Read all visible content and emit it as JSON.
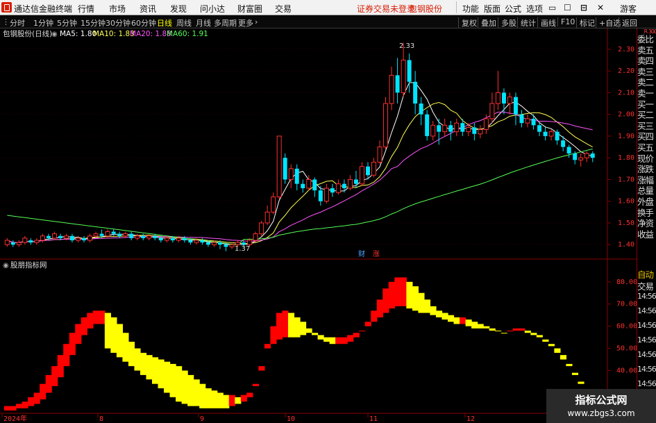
{
  "menu": {
    "app_title": "通达信金融终端",
    "items": [
      "行情",
      "市场",
      "资讯",
      "发现",
      "问小达",
      "财富圈",
      "交易"
    ],
    "notice": "证券交易未登录",
    "stock_name": "包钢股份",
    "right_items": [
      "功能",
      "版面",
      "公式",
      "选项"
    ],
    "guest": "游客",
    "accent_color": "#d81e06"
  },
  "toolbar": {
    "periods": [
      "分时",
      "1分钟",
      "5分钟",
      "15分钟",
      "30分钟",
      "60分钟",
      "日线",
      "周线",
      "月线",
      "多周期",
      "更多"
    ],
    "active_period": "日线",
    "right_buttons": [
      "复权",
      "叠加",
      "多股",
      "统计",
      "画线",
      "F10",
      "标记",
      "+自选",
      "返回"
    ]
  },
  "main_chart": {
    "header": "包钢股份(日线)",
    "ma_legend": [
      {
        "label": "MA5: 1.80",
        "color": "#ffffff"
      },
      {
        "label": "MA10: 1.83",
        "color": "#ffff55"
      },
      {
        "label": "MA20: 1.88",
        "color": "#ff55ff"
      },
      {
        "label": "MA60: 1.91",
        "color": "#55ff55"
      }
    ],
    "price_ticks": [
      "2.30",
      "2.20",
      "2.10",
      "2.00",
      "1.90",
      "1.80",
      "1.70",
      "1.60",
      "1.50",
      "1.40"
    ],
    "high_label": "2.33",
    "low_label": "1.37",
    "event_markers": [
      "财",
      "涨"
    ]
  },
  "indicator": {
    "title": "股朋指标网",
    "ticks": [
      "80.00",
      "70.00",
      "60.00",
      "50.00",
      "40.00",
      "30.00"
    ]
  },
  "date_axis": [
    "2024年",
    "8",
    "9",
    "10",
    "11",
    "12"
  ],
  "sidebar": {
    "top_label": "R 300",
    "items": [
      "委比",
      "卖五",
      "卖四",
      "卖三",
      "卖二",
      "卖一",
      "买一",
      "买二",
      "买三",
      "买四",
      "买五",
      "现价",
      "涨跌",
      "涨幅",
      "总量",
      "外盘",
      "换手",
      "净资",
      "收益"
    ],
    "lower_items": [
      "自动",
      "交易"
    ],
    "time_rows": [
      "14:56",
      "14:56",
      "14:56",
      "14:56",
      "14:56",
      "14:56",
      "14:56",
      "14:56"
    ]
  },
  "watermark": {
    "title": "指标公式网",
    "url": "www.zbgs3.com"
  },
  "chart_data": {
    "type": "candlestick",
    "title": "包钢股份(日线)",
    "price_range": [
      1.34,
      2.37
    ],
    "candles": [
      [
        1.4,
        1.42,
        1.39,
        1.43
      ],
      [
        1.41,
        1.4,
        1.39,
        1.42
      ],
      [
        1.4,
        1.41,
        1.39,
        1.42
      ],
      [
        1.41,
        1.43,
        1.4,
        1.44
      ],
      [
        1.42,
        1.41,
        1.4,
        1.43
      ],
      [
        1.41,
        1.42,
        1.4,
        1.43
      ],
      [
        1.42,
        1.44,
        1.41,
        1.45
      ],
      [
        1.44,
        1.43,
        1.42,
        1.45
      ],
      [
        1.43,
        1.45,
        1.42,
        1.46
      ],
      [
        1.44,
        1.43,
        1.42,
        1.45
      ],
      [
        1.43,
        1.44,
        1.42,
        1.45
      ],
      [
        1.44,
        1.42,
        1.41,
        1.45
      ],
      [
        1.42,
        1.43,
        1.41,
        1.44
      ],
      [
        1.43,
        1.42,
        1.41,
        1.44
      ],
      [
        1.42,
        1.44,
        1.41,
        1.45
      ],
      [
        1.44,
        1.45,
        1.43,
        1.46
      ],
      [
        1.45,
        1.44,
        1.43,
        1.47
      ],
      [
        1.44,
        1.46,
        1.43,
        1.47
      ],
      [
        1.46,
        1.45,
        1.44,
        1.47
      ],
      [
        1.45,
        1.44,
        1.43,
        1.46
      ],
      [
        1.44,
        1.45,
        1.43,
        1.46
      ],
      [
        1.45,
        1.43,
        1.42,
        1.46
      ],
      [
        1.43,
        1.44,
        1.42,
        1.45
      ],
      [
        1.44,
        1.43,
        1.42,
        1.45
      ],
      [
        1.43,
        1.44,
        1.42,
        1.45
      ],
      [
        1.44,
        1.43,
        1.42,
        1.45
      ],
      [
        1.43,
        1.42,
        1.41,
        1.44
      ],
      [
        1.42,
        1.43,
        1.41,
        1.44
      ],
      [
        1.43,
        1.42,
        1.41,
        1.44
      ],
      [
        1.42,
        1.43,
        1.41,
        1.44
      ],
      [
        1.43,
        1.42,
        1.41,
        1.44
      ],
      [
        1.42,
        1.41,
        1.4,
        1.43
      ],
      [
        1.41,
        1.42,
        1.4,
        1.43
      ],
      [
        1.42,
        1.41,
        1.4,
        1.43
      ],
      [
        1.41,
        1.4,
        1.39,
        1.42
      ],
      [
        1.4,
        1.41,
        1.39,
        1.42
      ],
      [
        1.41,
        1.4,
        1.38,
        1.42
      ],
      [
        1.4,
        1.39,
        1.37,
        1.41
      ],
      [
        1.39,
        1.4,
        1.38,
        1.41
      ],
      [
        1.4,
        1.41,
        1.39,
        1.42
      ],
      [
        1.41,
        1.4,
        1.39,
        1.42
      ],
      [
        1.4,
        1.42,
        1.39,
        1.43
      ],
      [
        1.42,
        1.45,
        1.41,
        1.46
      ],
      [
        1.45,
        1.5,
        1.44,
        1.51
      ],
      [
        1.5,
        1.55,
        1.49,
        1.58
      ],
      [
        1.55,
        1.62,
        1.54,
        1.64
      ],
      [
        1.62,
        1.9,
        1.61,
        1.9
      ],
      [
        1.8,
        1.7,
        1.68,
        1.82
      ],
      [
        1.7,
        1.75,
        1.66,
        1.77
      ],
      [
        1.75,
        1.68,
        1.65,
        1.77
      ],
      [
        1.68,
        1.66,
        1.64,
        1.7
      ],
      [
        1.66,
        1.7,
        1.65,
        1.72
      ],
      [
        1.7,
        1.65,
        1.62,
        1.71
      ],
      [
        1.65,
        1.6,
        1.58,
        1.67
      ],
      [
        1.6,
        1.66,
        1.59,
        1.68
      ],
      [
        1.66,
        1.64,
        1.62,
        1.68
      ],
      [
        1.64,
        1.68,
        1.63,
        1.7
      ],
      [
        1.68,
        1.66,
        1.64,
        1.7
      ],
      [
        1.66,
        1.7,
        1.65,
        1.72
      ],
      [
        1.7,
        1.68,
        1.66,
        1.74
      ],
      [
        1.68,
        1.76,
        1.67,
        1.78
      ],
      [
        1.76,
        1.72,
        1.7,
        1.78
      ],
      [
        1.72,
        1.78,
        1.71,
        1.8
      ],
      [
        1.78,
        1.85,
        1.77,
        1.88
      ],
      [
        1.85,
        2.05,
        1.84,
        2.08
      ],
      [
        2.05,
        2.18,
        2.02,
        2.22
      ],
      [
        2.18,
        2.1,
        2.05,
        2.26
      ],
      [
        2.1,
        2.25,
        2.08,
        2.33
      ],
      [
        2.25,
        2.15,
        2.1,
        2.28
      ],
      [
        2.15,
        2.05,
        2.0,
        2.2
      ],
      [
        2.05,
        2.0,
        1.95,
        2.08
      ],
      [
        2.0,
        1.9,
        1.88,
        2.02
      ],
      [
        1.9,
        1.95,
        1.88,
        1.97
      ],
      [
        1.95,
        1.92,
        1.86,
        1.98
      ],
      [
        1.92,
        1.95,
        1.9,
        1.98
      ],
      [
        1.95,
        1.92,
        1.88,
        1.97
      ],
      [
        1.92,
        1.96,
        1.9,
        1.98
      ],
      [
        1.96,
        1.92,
        1.9,
        1.98
      ],
      [
        1.92,
        1.94,
        1.9,
        1.96
      ],
      [
        1.94,
        1.91,
        1.88,
        1.96
      ],
      [
        1.91,
        1.93,
        1.89,
        1.95
      ],
      [
        1.93,
        1.98,
        1.91,
        2.0
      ],
      [
        1.98,
        2.05,
        1.96,
        2.1
      ],
      [
        2.05,
        2.1,
        2.02,
        2.2
      ],
      [
        2.1,
        2.05,
        2.0,
        2.12
      ],
      [
        2.05,
        2.08,
        2.0,
        2.1
      ],
      [
        2.08,
        2.0,
        1.95,
        2.1
      ],
      [
        2.0,
        1.96,
        1.94,
        2.02
      ],
      [
        1.96,
        1.98,
        1.94,
        2.0
      ],
      [
        1.98,
        1.95,
        1.93,
        2.0
      ],
      [
        1.95,
        1.92,
        1.9,
        1.96
      ],
      [
        1.92,
        1.9,
        1.88,
        1.94
      ],
      [
        1.9,
        1.92,
        1.88,
        1.93
      ],
      [
        1.92,
        1.88,
        1.86,
        1.93
      ],
      [
        1.88,
        1.85,
        1.83,
        1.9
      ],
      [
        1.85,
        1.82,
        1.8,
        1.86
      ],
      [
        1.82,
        1.79,
        1.77,
        1.83
      ],
      [
        1.79,
        1.8,
        1.76,
        1.82
      ],
      [
        1.8,
        1.82,
        1.78,
        1.83
      ],
      [
        1.82,
        1.8,
        1.78,
        1.83
      ]
    ],
    "ma_series": [
      {
        "name": "MA5",
        "color": "#ffffff",
        "values": []
      },
      {
        "name": "MA10",
        "color": "#ffff55",
        "values": []
      },
      {
        "name": "MA20",
        "color": "#ff55ff",
        "values": []
      },
      {
        "name": "MA60",
        "color": "#55ff55",
        "values": []
      }
    ],
    "indicator_range": [
      22,
      84
    ],
    "indicator_bands": [
      {
        "color": "#ff0000",
        "fill_when": "upper_rising"
      },
      {
        "color": "#ffff00",
        "fill_when": "upper_falling"
      }
    ],
    "indicator_upper": [
      24,
      24,
      25,
      26,
      28,
      30,
      34,
      38,
      42,
      47,
      52,
      57,
      61,
      64,
      66,
      67,
      67,
      66,
      64,
      61,
      57,
      53,
      50,
      48,
      47,
      46,
      45,
      44,
      43,
      42,
      40,
      38,
      36,
      34,
      32,
      31,
      30,
      29,
      29,
      28,
      29,
      30,
      34,
      42,
      52,
      60,
      66,
      67,
      66,
      64,
      62,
      59,
      56,
      54,
      53,
      52,
      52,
      52,
      53,
      55,
      58,
      62,
      67,
      72,
      77,
      80,
      82,
      82,
      80,
      78,
      75,
      72,
      69,
      67,
      66,
      65,
      64,
      64,
      63,
      62,
      61,
      60,
      59,
      58,
      57,
      58,
      59,
      59,
      58,
      57,
      56,
      54,
      52,
      50,
      47,
      43,
      39,
      35,
      31,
      28
    ],
    "indicator_lower": [
      22,
      22,
      23,
      23,
      24,
      25,
      27,
      30,
      33,
      37,
      42,
      47,
      52,
      56,
      59,
      61,
      61,
      50,
      48,
      46,
      44,
      42,
      40,
      38,
      36,
      34,
      32,
      30,
      28,
      26,
      25,
      24,
      24,
      23,
      23,
      23,
      23,
      23,
      24,
      25,
      26,
      28,
      33,
      40,
      50,
      52,
      54,
      55,
      55,
      55,
      56,
      57,
      57,
      56,
      55,
      55,
      55,
      55,
      56,
      57,
      58,
      60,
      62,
      64,
      66,
      68,
      69,
      69,
      68,
      67,
      66,
      66,
      65,
      64,
      63,
      62,
      61,
      61,
      60,
      59,
      59,
      59,
      58,
      58,
      57,
      58,
      58,
      58,
      57,
      56,
      55,
      53,
      51,
      48,
      45,
      42,
      38,
      34,
      30,
      27
    ],
    "date_labels": [
      "2024年",
      "8",
      "9",
      "10",
      "11",
      "12"
    ]
  }
}
